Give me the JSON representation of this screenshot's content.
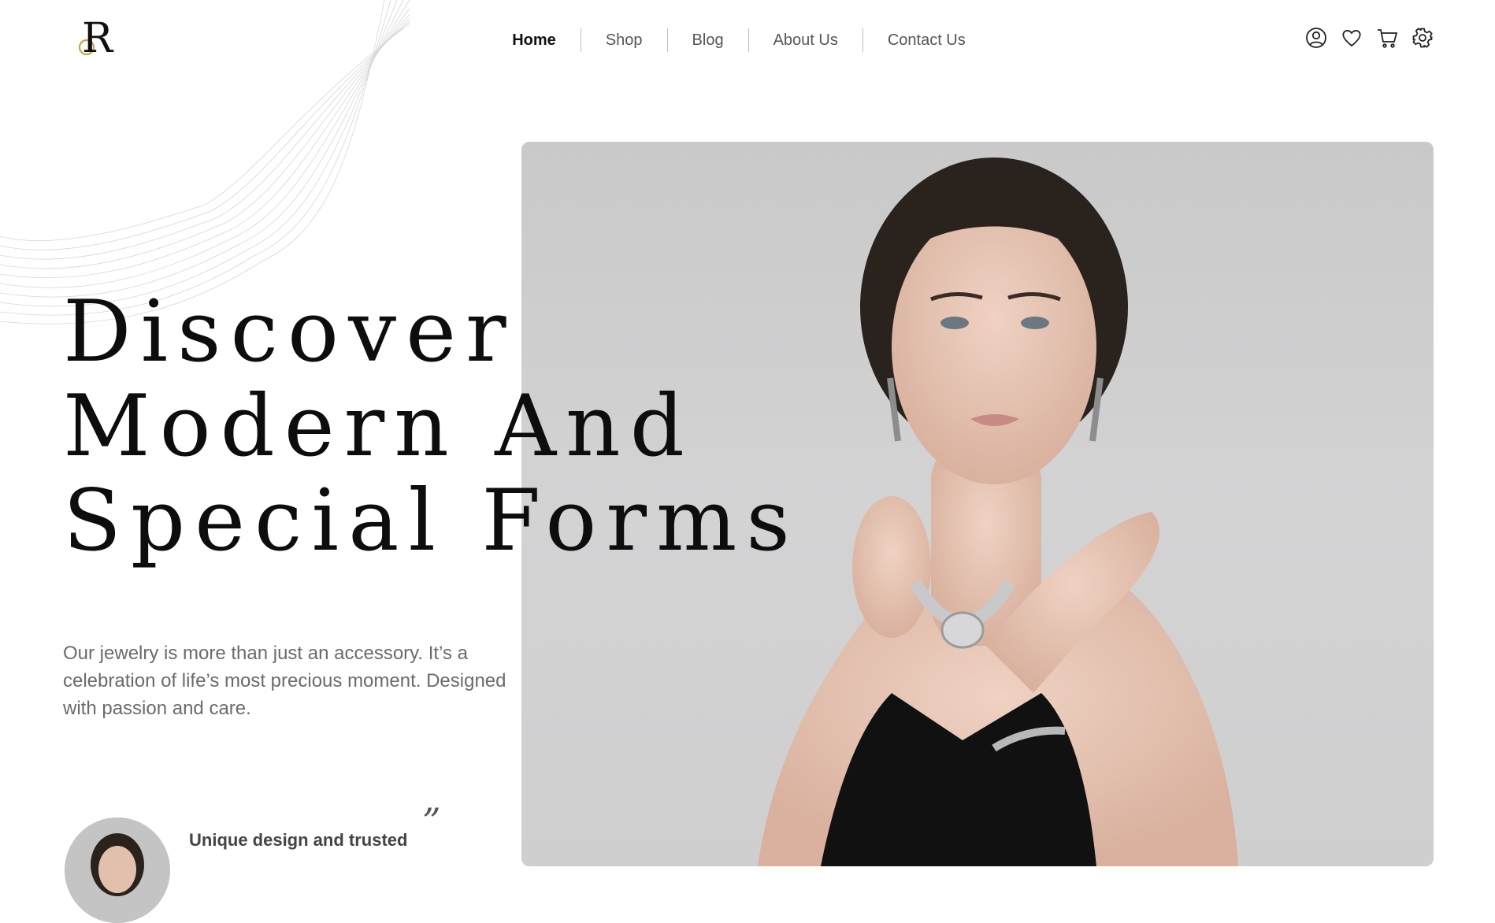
{
  "brand": {
    "logo_letter": "R",
    "logo_icon": "monogram-logo"
  },
  "nav": {
    "items": [
      {
        "label": "Home",
        "active": true
      },
      {
        "label": "Shop",
        "active": false
      },
      {
        "label": "Blog",
        "active": false
      },
      {
        "label": "About Us",
        "active": false
      },
      {
        "label": "Contact Us",
        "active": false
      }
    ]
  },
  "header_icons": [
    "user-icon",
    "heart-icon",
    "cart-icon",
    "settings-icon"
  ],
  "hero": {
    "headline_lines": [
      "Discover",
      "Modern And",
      "Special Forms"
    ],
    "description": "Our jewelry is more than just an accessory. It’s a celebration of life’s most precious moment. Designed with passion and care.",
    "quote_mark": "”",
    "testimonial_title": "Unique design and trusted"
  },
  "colors": {
    "text": "#111111",
    "muted": "#6b6b6b",
    "photo_bg": "#cfcfd0",
    "divider": "#bdbdbd"
  }
}
